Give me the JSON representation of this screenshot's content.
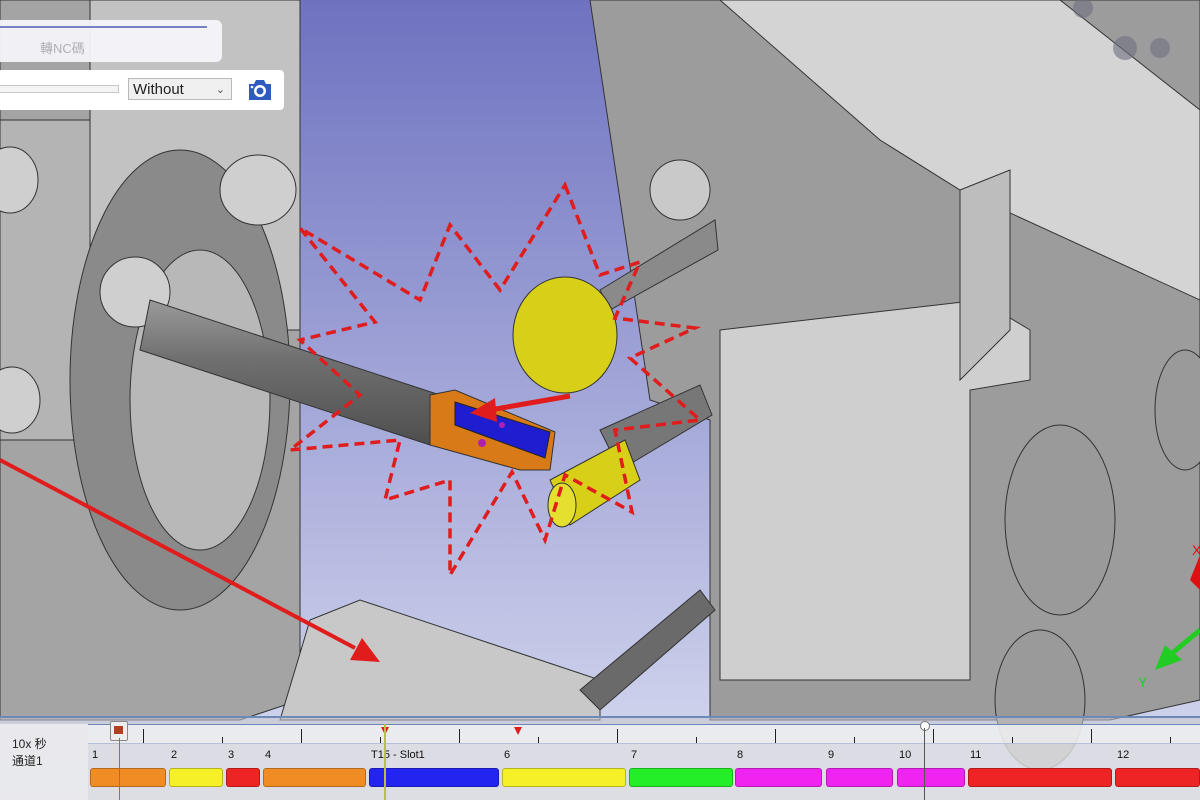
{
  "toolbar": {
    "nc_button_label": "轉NC碼",
    "display_mode_select": "Without",
    "camera_icon": "camera-icon",
    "accent_color": "#2f5bbf"
  },
  "timeline": {
    "speed_label": "10x 秒",
    "channel_label": "通道1",
    "segments": [
      {
        "label": "1",
        "color": "#f08c24"
      },
      {
        "label": "2",
        "color": "#f5f028"
      },
      {
        "label": "3",
        "color": "#ee2424"
      },
      {
        "label": "4",
        "color": "#f08c24"
      },
      {
        "label": "T15 - Slot1",
        "color": "#2424f0"
      },
      {
        "label": "6",
        "color": "#f5f028"
      },
      {
        "label": "7",
        "color": "#24ee28"
      },
      {
        "label": "8",
        "color": "#f024f0"
      },
      {
        "label": "9",
        "color": "#f024f0"
      },
      {
        "label": "10",
        "color": "#f024f0"
      },
      {
        "label": "11",
        "color": "#ee2424"
      },
      {
        "label": "12",
        "color": "#ee2424"
      }
    ]
  },
  "viewport": {
    "axis_labels": [
      "X",
      "Y"
    ],
    "collision_marker_color": "#e01c1c"
  }
}
